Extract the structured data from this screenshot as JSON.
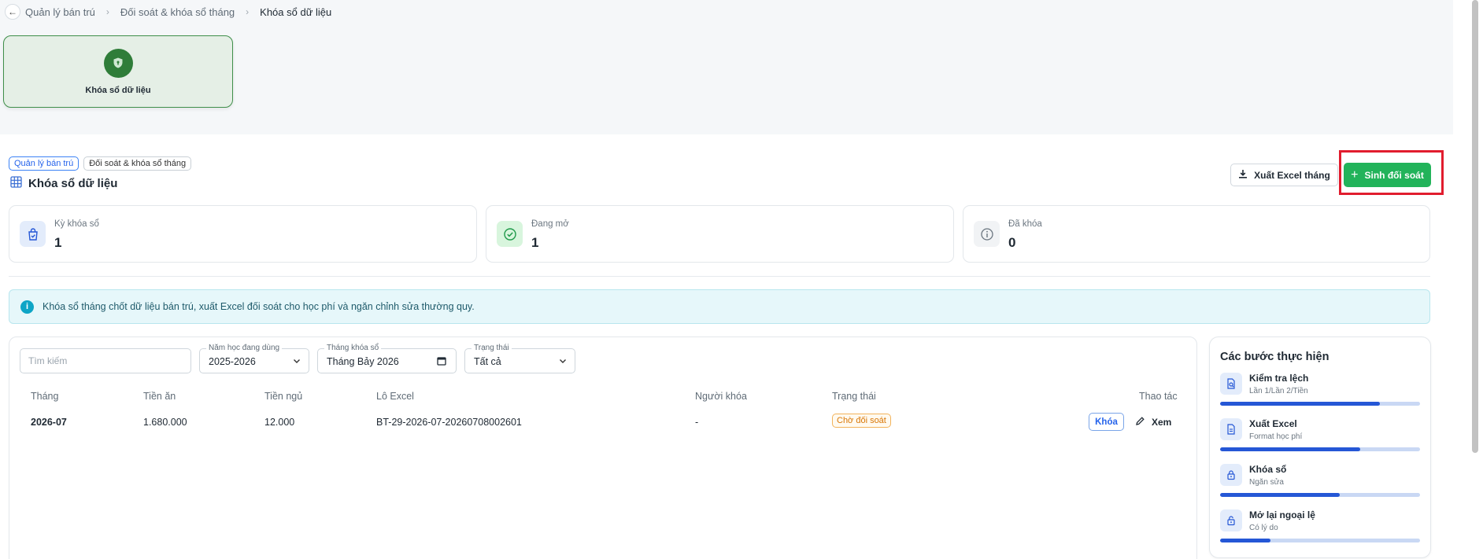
{
  "breadcrumb": {
    "items": [
      "Quản lý bán trú",
      "Đối soát & khóa sổ tháng",
      "Khóa sổ dữ liệu"
    ]
  },
  "hero_card": {
    "label": "Khóa sổ dữ liệu",
    "icon": "shield-icon"
  },
  "header": {
    "tags": [
      "Quản lý bán trú",
      "Đối soát & khóa sổ tháng"
    ],
    "title": "Khóa sổ dữ liệu",
    "export_label": "Xuất Excel tháng",
    "generate_label": "Sinh đối soát"
  },
  "stats": [
    {
      "label": "Kỳ khóa sổ",
      "value": "1",
      "icon": "bag-check-icon"
    },
    {
      "label": "Đang mở",
      "value": "1",
      "icon": "check-circle-icon"
    },
    {
      "label": "Đã khóa",
      "value": "0",
      "icon": "info-circle-icon"
    }
  ],
  "info_banner": {
    "text": "Khóa sổ tháng chốt dữ liệu bán trú, xuất Excel đối soát cho học phí và ngăn chỉnh sửa thường quy."
  },
  "filters": {
    "search_placeholder": "Tìm kiếm",
    "school_year": {
      "label": "Năm học đang dùng",
      "value": "2025-2026"
    },
    "month": {
      "label": "Tháng khóa sổ",
      "value": "Tháng Bảy  2026"
    },
    "status": {
      "label": "Trạng thái",
      "value": "Tất cả"
    }
  },
  "table": {
    "columns": [
      "Tháng",
      "Tiền ăn",
      "Tiền ngủ",
      "Lô Excel",
      "Người khóa",
      "Trạng thái",
      "Thao tác"
    ],
    "rows": [
      {
        "month": "2026-07",
        "meal_fee": "1.680.000",
        "nap_fee": "12.000",
        "excel_batch": "BT-29-2026-07-20260708002601",
        "locked_by": "-",
        "status": "Chờ đối soát",
        "lock_label": "Khóa",
        "view_label": "Xem"
      }
    ]
  },
  "steps": {
    "title": "Các bước thực hiện",
    "items": [
      {
        "title": "Kiểm tra lệch",
        "subtitle": "Lần 1/Lần 2/Tiền",
        "progress": 0.8,
        "icon": "search-doc-icon"
      },
      {
        "title": "Xuất Excel",
        "subtitle": "Format học phí",
        "progress": 0.7,
        "icon": "file-icon"
      },
      {
        "title": "Khóa sổ",
        "subtitle": "Ngăn sửa",
        "progress": 0.6,
        "icon": "lock-icon"
      },
      {
        "title": "Mở lại ngoại lệ",
        "subtitle": "Có lý do",
        "progress": 0.25,
        "icon": "unlock-icon"
      }
    ]
  },
  "colors": {
    "accent_green": "#22b35a",
    "hero_green": "#2f7d39",
    "highlight_red": "#e11d2e",
    "primary_blue": "#2563eb",
    "status_orange": "#d97706"
  }
}
